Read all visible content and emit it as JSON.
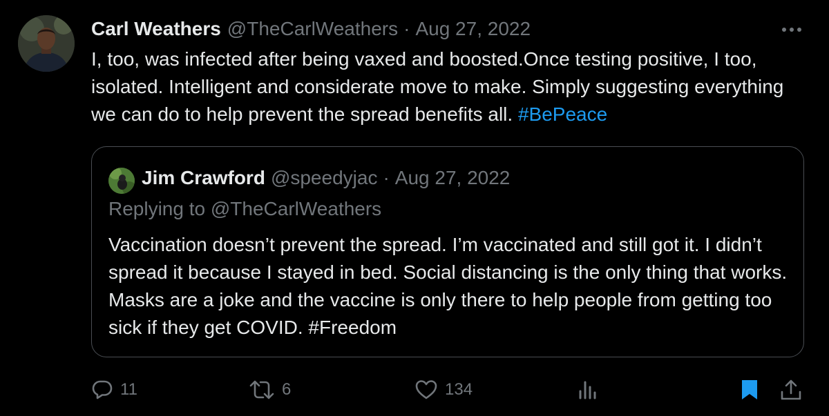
{
  "tweet": {
    "author_name": "Carl Weathers",
    "author_handle": "@TheCarlWeathers",
    "separator": "·",
    "date": "Aug 27, 2022",
    "text": "I, too, was infected after being vaxed and boosted.Once testing positive, I too, isolated. Intelligent and considerate move to make. Simply suggesting everything we can do to help prevent the spread benefits all. ",
    "hashtag": "#BePeace"
  },
  "quote": {
    "author_name": "Jim Crawford",
    "author_handle": "@speedyjac",
    "separator": "·",
    "date": "Aug 27, 2022",
    "replying_to": "Replying to @TheCarlWeathers",
    "text": "Vaccination doesn’t prevent the spread. I’m vaccinated and still got it. I didn’t spread it because I stayed in bed. Social distancing is the only thing that works. Masks are a joke and the vaccine is only there to help people from getting too sick if they get COVID. #Freedom"
  },
  "actions": {
    "replies": "11",
    "retweets": "6",
    "likes": "134"
  },
  "icons": {
    "more": "more-dots-icon",
    "reply": "reply-icon",
    "retweet": "retweet-icon",
    "like": "heart-icon",
    "views": "analytics-icon",
    "bookmark": "bookmark-icon",
    "share": "share-icon"
  },
  "colors": {
    "background": "#000000",
    "text": "#e7e9ea",
    "muted": "#71767b",
    "accent": "#1d9bf0",
    "border": "#4a4e53"
  }
}
